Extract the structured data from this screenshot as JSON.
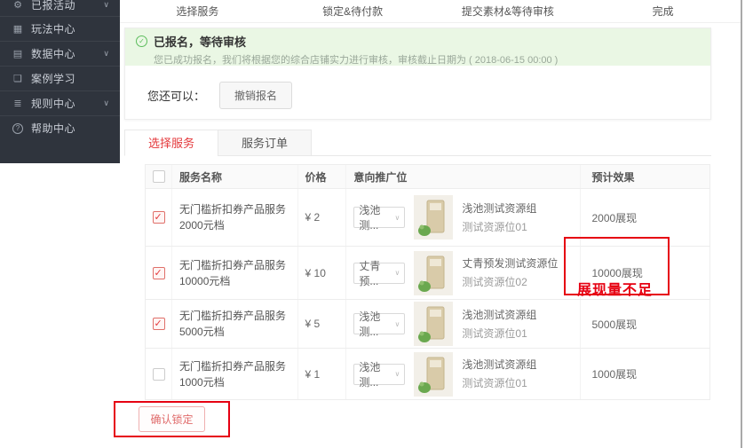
{
  "sidebar": {
    "items": [
      {
        "icon": "gear-icon",
        "glyph": "⚙",
        "label": "已报活动",
        "chevron": "∨"
      },
      {
        "icon": "gift-icon",
        "glyph": "▦",
        "label": "玩法中心",
        "chevron": ""
      },
      {
        "icon": "chart-icon",
        "glyph": "▤",
        "label": "数据中心",
        "chevron": "∨"
      },
      {
        "icon": "book-icon",
        "glyph": "❏",
        "label": "案例学习",
        "chevron": ""
      },
      {
        "icon": "rules-icon",
        "glyph": "≣",
        "label": "规则中心",
        "chevron": "∨"
      },
      {
        "icon": "help-icon",
        "glyph": "?",
        "label": "帮助中心",
        "chevron": ""
      }
    ]
  },
  "steps": {
    "labels": [
      "选择服务",
      "锁定&待付款",
      "提交素材&等待审核",
      "完成"
    ]
  },
  "alert": {
    "icon": "check-circle-icon",
    "check_glyph": "✓",
    "title": "已报名，等待审核",
    "desc": "您已成功报名，我们将根据您的综合店铺实力进行审核，审核截止日期为 ( 2018-06-15 00:00 )"
  },
  "actions": {
    "hint": "您还可以：",
    "cancel_label": "撤销报名"
  },
  "tabs": [
    {
      "label": "选择服务",
      "active": true
    },
    {
      "label": "服务订单",
      "active": false
    }
  ],
  "table": {
    "headers": {
      "name": "服务名称",
      "price": "价格",
      "slot": "意向推广位",
      "effect": "预计效果"
    },
    "rows": [
      {
        "checked": true,
        "name": "无门槛折扣券产品服务2000元档",
        "price": "¥ 2",
        "slot_select": "浅池测...",
        "resource_group": "浅池测试资源组",
        "resource_slot": "测试资源位01",
        "effect": "2000展现"
      },
      {
        "checked": true,
        "name": "无门槛折扣券产品服务10000元档",
        "price": "¥ 10",
        "slot_select": "丈青预...",
        "resource_group": "丈青预发测试资源位",
        "resource_slot": "测试资源位02",
        "effect": "10000展现"
      },
      {
        "checked": true,
        "name": "无门槛折扣券产品服务5000元档",
        "price": "¥ 5",
        "slot_select": "浅池测...",
        "resource_group": "浅池测试资源组",
        "resource_slot": "测试资源位01",
        "effect": "5000展现"
      },
      {
        "checked": false,
        "name": "无门槛折扣券产品服务1000元档",
        "price": "¥ 1",
        "slot_select": "浅池测...",
        "resource_group": "浅池测试资源组",
        "resource_slot": "测试资源位01",
        "effect": "1000展现"
      }
    ],
    "select_chevron": "∨"
  },
  "annotations": {
    "insufficient_label": "展现量不足"
  },
  "confirm": {
    "label": "确认锁定"
  },
  "colors": {
    "sidebar_bg": "#2f343d",
    "alert_bg": "#eaf7e4",
    "alert_green": "#5dbd5d",
    "tab_active_red": "#e4393c",
    "annotation_red": "#e60012",
    "checkbox_red": "#e4393c"
  }
}
